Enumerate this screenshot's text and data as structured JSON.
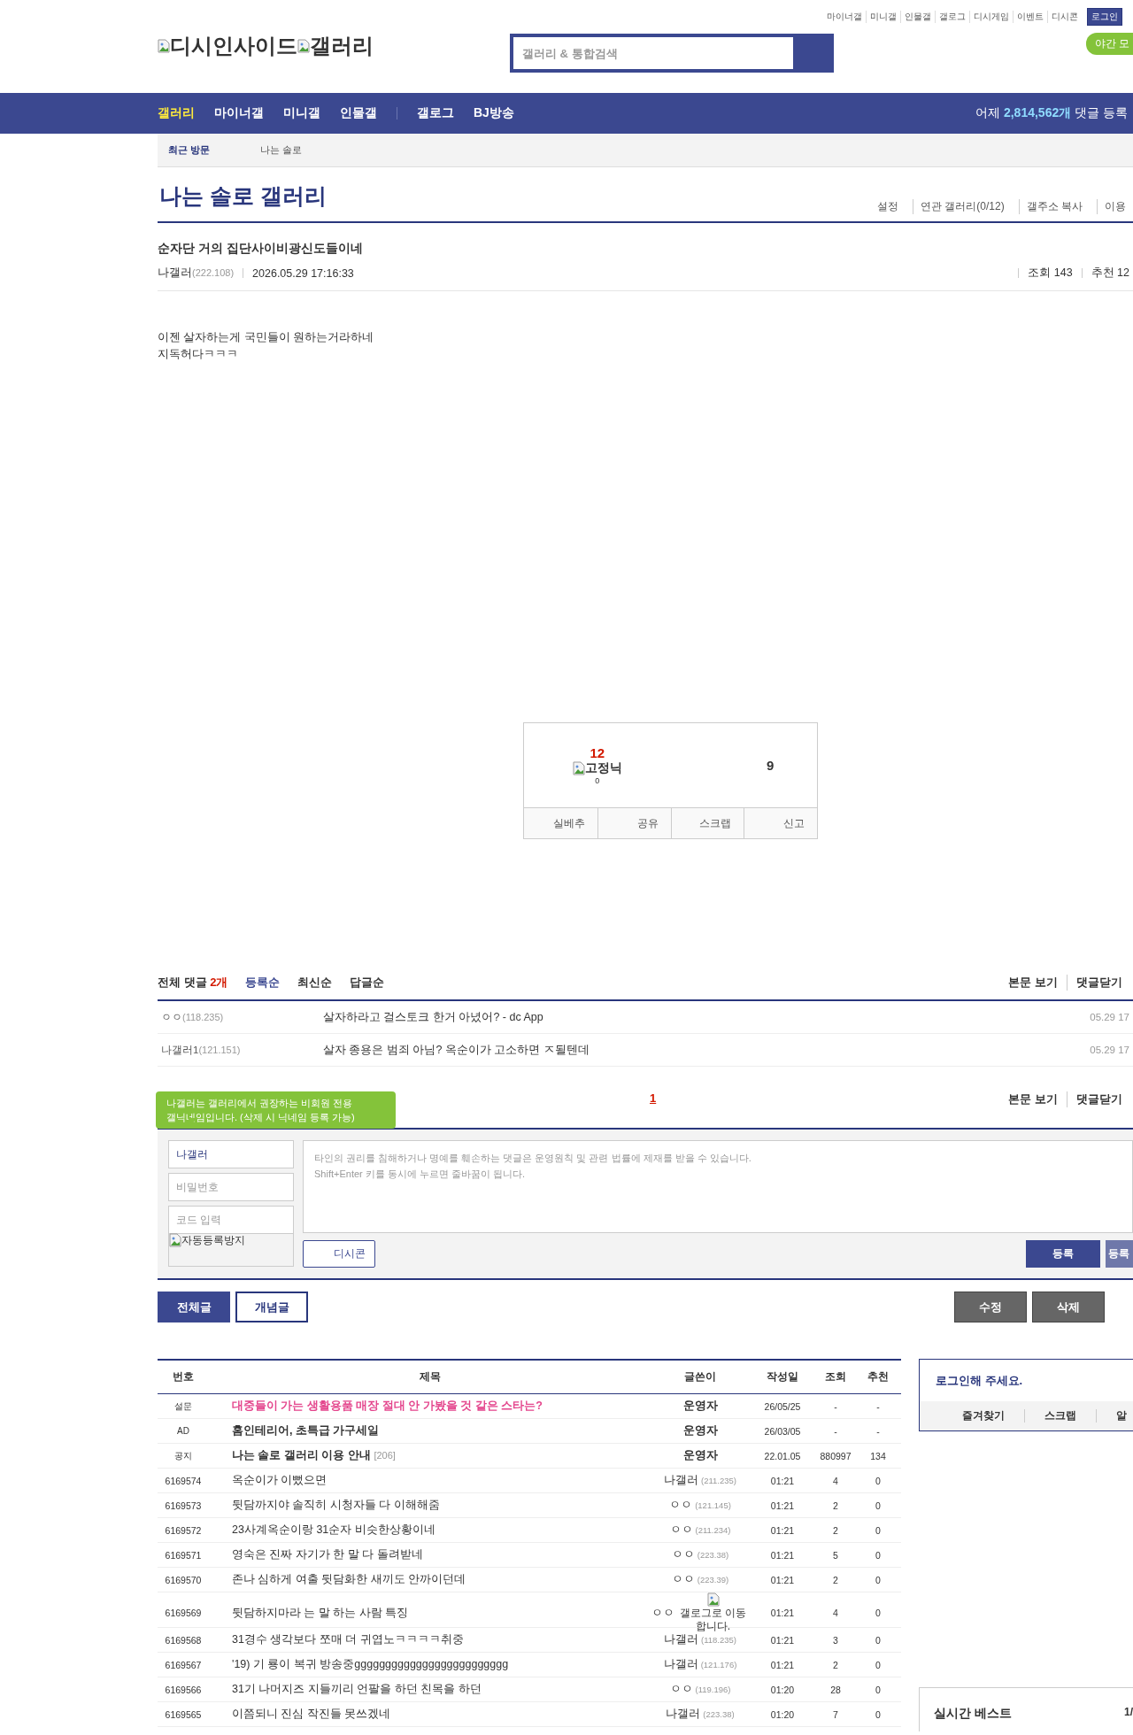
{
  "top_links": [
    "마이너갤",
    "미니갤",
    "인물갤",
    "갤로그",
    "디시게임",
    "이벤트",
    "디시콘"
  ],
  "login_button": "로그인",
  "night_mode": "야간 모",
  "logo": {
    "parts": [
      "디시인사이드",
      "갤러리"
    ]
  },
  "search": {
    "placeholder": "갤러리 & 통합검색"
  },
  "nav": {
    "items": [
      {
        "label": "갤러리",
        "selected": true,
        "divider_before": false
      },
      {
        "label": "마이너갤",
        "selected": false,
        "divider_before": false
      },
      {
        "label": "미니갤",
        "selected": false,
        "divider_before": false
      },
      {
        "label": "인물갤",
        "selected": false,
        "divider_before": false
      },
      {
        "label": "갤로그",
        "selected": false,
        "divider_before": true
      },
      {
        "label": "BJ방송",
        "selected": false,
        "divider_before": false
      }
    ],
    "stat_prefix": "어제",
    "stat_value": "2,814,562개",
    "stat_suffix": "댓글 등록"
  },
  "recent": {
    "label": "최근 방문",
    "items": [
      "나는 솔로"
    ]
  },
  "gallery": {
    "title": "나는 솔로 갤러리",
    "links": [
      "설정",
      "연관 갤러리(0/12)",
      "갤주소 복사",
      "이용"
    ]
  },
  "post": {
    "title": "순자단 거의 집단사이비광신도들이네",
    "author": "나갤러",
    "ip": "(222.108)",
    "date": "2026.05.29 17:16:33",
    "views": "조회 143",
    "recommend": "추천 12",
    "body": [
      "이젠 살자하는게 국민들이 원하는거라하네",
      "지독허다ㅋㅋㅋ"
    ]
  },
  "vote": {
    "up_count": "12",
    "fixed_label": "고정닉",
    "fixed_count": "0",
    "down_count": "9",
    "actions": [
      "실베추",
      "공유",
      "스크랩",
      "신고"
    ]
  },
  "comments": {
    "title": "전체 댓글",
    "count": "2개",
    "sorts": [
      {
        "label": "등록순",
        "selected": true
      },
      {
        "label": "최신순",
        "selected": false
      },
      {
        "label": "답글순",
        "selected": false
      }
    ],
    "links": [
      "본문 보기",
      "댓글닫기"
    ],
    "items": [
      {
        "author": "ㅇㅇ",
        "ip": "(118.235)",
        "text": "살자하라고 걸스토크 한거 아녔어? - dc App",
        "date": "05.29 17"
      },
      {
        "author": "나갤러1",
        "ip": "(121.151)",
        "text": "살자 종용은 범죄 아님? 옥순이가 고소하면 ㅈ될텐데",
        "date": "05.29 17"
      }
    ],
    "pages": [
      {
        "label": "1",
        "selected": true
      }
    ],
    "bottom_links": [
      "본문 보기",
      "댓글닫기"
    ]
  },
  "form": {
    "tooltip": "나갤러는 갤러리에서 권장하는 비회원 전용 갤닉네임입니다. (삭제 시 닉네임 등록 가능)",
    "name_value": "나갤러",
    "password_placeholder": "비밀번호",
    "code_placeholder": "코드 입력",
    "captcha_alt": "자동등록방지",
    "textarea_placeholder": "타인의 권리를 침해하거나 명예를 훼손하는 댓글은 운영원칙 및 관련 법률에 제재를 받을 수 있습니다.\nShift+Enter 키를 동시에 누르면 줄바꿈이 됩니다.",
    "dccon_button": "디시콘",
    "submit_buttons": [
      {
        "label": "등록",
        "disabled": false
      },
      {
        "label": "등록",
        "disabled": true
      }
    ]
  },
  "list_buttons": [
    {
      "label": "전체글",
      "selected": true
    },
    {
      "label": "개념글",
      "selected": false
    }
  ],
  "action_buttons": [
    "수정",
    "삭제"
  ],
  "table": {
    "columns": [
      "번호",
      "제목",
      "글쓴이",
      "작성일",
      "조회",
      "추천"
    ],
    "rows": [
      {
        "kind": "survey",
        "number": "설문",
        "title": "대중들이 가는 생활용품 매장 절대 안 가봤을 것 같은 스타는?",
        "writer": "운영자",
        "date": "26/05/25",
        "views": "-",
        "recommends": "-"
      },
      {
        "kind": "ad",
        "number": "AD",
        "title": "홈인테리어, 초특급 가구세일",
        "writer": "운영자",
        "date": "26/03/05",
        "views": "-",
        "recommends": "-"
      },
      {
        "kind": "notice",
        "number": "공지",
        "title": "나는 솔로 갤러리 이용 안내",
        "reply_count": "[206]",
        "writer": "운영자",
        "date": "22.01.05",
        "views": "880997",
        "recommends": "134"
      },
      {
        "kind": "normal",
        "number": "6169574",
        "title": "옥순이가 이뻤으면",
        "writer": "나갤러",
        "ip": "(211.235)",
        "date": "01:21",
        "views": "4",
        "recommends": "0"
      },
      {
        "kind": "normal",
        "number": "6169573",
        "title": "뒷담까지야 솔직히 시청자들 다 이해해줌",
        "writer": "ㅇㅇ",
        "ip": "(121.145)",
        "date": "01:21",
        "views": "2",
        "recommends": "0"
      },
      {
        "kind": "normal",
        "number": "6169572",
        "title": "23사계옥순이랑 31순자 비슷한상황이네",
        "writer": "ㅇㅇ",
        "ip": "(211.234)",
        "date": "01:21",
        "views": "2",
        "recommends": "0"
      },
      {
        "kind": "normal",
        "number": "6169571",
        "title": "영숙은 진짜 자기가 한 말 다 돌려받네",
        "writer": "ㅇㅇ",
        "ip": "(223.38)",
        "date": "01:21",
        "views": "5",
        "recommends": "0"
      },
      {
        "kind": "normal",
        "number": "6169570",
        "title": "존나 심하게 여출 뒷담화한 새끼도 안까이던데",
        "writer": "ㅇㅇ",
        "ip": "(223.39)",
        "date": "01:21",
        "views": "2",
        "recommends": "0"
      },
      {
        "kind": "normal",
        "number": "6169569",
        "title": "뒷담하지마라 는 말 하는 사람 특징",
        "writer": "ㅇㅇ",
        "writer_image_alt": "갤로그로 이동합니다.",
        "date": "01:21",
        "views": "4",
        "recommends": "0"
      },
      {
        "kind": "normal",
        "number": "6169568",
        "title": "31경수 생각보다 쪼매 더 귀엽노ㅋㅋㅋㅋ취중",
        "writer": "나갤러",
        "ip": "(118.235)",
        "date": "01:21",
        "views": "3",
        "recommends": "0"
      },
      {
        "kind": "normal",
        "number": "6169567",
        "title": "'19) 기 룡이 복귀 방송중ggggggggggggggggggggggggg",
        "writer": "나갤러",
        "ip": "(121.176)",
        "date": "01:21",
        "views": "2",
        "recommends": "0"
      },
      {
        "kind": "normal",
        "number": "6169566",
        "title": "31기 나머지즈 지들끼리 언팔을 하던 친목을 하던",
        "writer": "ㅇㅇ",
        "ip": "(119.196)",
        "date": "01:20",
        "views": "28",
        "recommends": "0"
      },
      {
        "kind": "normal",
        "number": "6169565",
        "title": "이쯤되니 진심 작진들 못쓰겠네",
        "writer": "나갤러",
        "ip": "(223.38)",
        "date": "01:20",
        "views": "7",
        "recommends": "0"
      }
    ]
  },
  "sidebar": {
    "login_prompt": "로그인해 주세요.",
    "tabs": [
      "즐겨찾기",
      "스크랩",
      "알"
    ],
    "best_title": "실시간 베스트",
    "best_page": "1/"
  }
}
